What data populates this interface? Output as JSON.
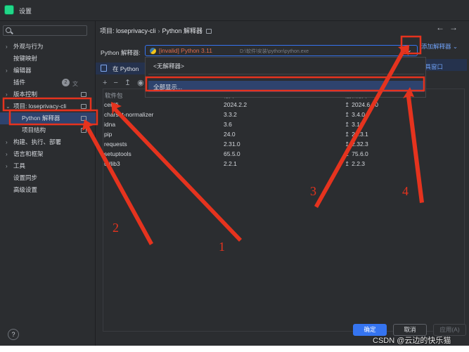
{
  "window": {
    "title": "设置"
  },
  "sidebar": {
    "search_placeholder": "Q",
    "items": [
      {
        "arrow": "›",
        "label": "外观与行为"
      },
      {
        "arrow": "",
        "label": "按键映射"
      },
      {
        "arrow": "›",
        "label": "编辑器"
      },
      {
        "arrow": "",
        "label": "插件",
        "badge": "2"
      },
      {
        "arrow": "›",
        "label": "版本控制"
      },
      {
        "arrow": "⌄",
        "label": "项目: loseprivacy-cli"
      },
      {
        "arrow": "",
        "label": "Python 解释器"
      },
      {
        "arrow": "",
        "label": "项目结构"
      },
      {
        "arrow": "›",
        "label": "构建、执行、部署"
      },
      {
        "arrow": "›",
        "label": "语言和框架"
      },
      {
        "arrow": "›",
        "label": "工具"
      },
      {
        "arrow": "",
        "label": "设置同步"
      },
      {
        "arrow": "",
        "label": "高级设置"
      }
    ],
    "help_label": "?"
  },
  "breadcrumb": {
    "project": "项目: loseprivacy-cli",
    "separator": "›",
    "page": "Python 解释器"
  },
  "nav": {
    "back": "←",
    "forward": "→"
  },
  "interpreter": {
    "label": "Python 解释器:",
    "invalid_text": "[invalid] Python 3.11",
    "path": "D:\\软件\\安装\\python\\python.exe",
    "add_link": "添加解释器 ⌄",
    "chevron": "⌄"
  },
  "notice": {
    "text": "在 Python",
    "tool_window_link": "工具窗口"
  },
  "dropdown": {
    "none_option": "<无解释器>",
    "show_all_option": "全部显示..."
  },
  "toolbar": {
    "add": "+",
    "remove": "−",
    "upgrade": "↥",
    "eye": "◉"
  },
  "table": {
    "headers": [
      "软件包",
      "版本",
      "最新版本"
    ],
    "rows": [
      [
        "certifi",
        "2024.2.2",
        "2024.6.30"
      ],
      [
        "charset-normalizer",
        "3.3.2",
        "3.4.0"
      ],
      [
        "idna",
        "3.6",
        "3.10"
      ],
      [
        "pip",
        "24.0",
        "24.3.1"
      ],
      [
        "requests",
        "2.31.0",
        "2.32.3"
      ],
      [
        "setuptools",
        "65.5.0",
        "75.6.0"
      ],
      [
        "urllib3",
        "2.2.1",
        "2.2.3"
      ]
    ]
  },
  "buttons": {
    "ok": "确定",
    "cancel": "取消",
    "apply": "应用(A)"
  },
  "annotations": {
    "numbers": [
      "1",
      "2",
      "3",
      "4"
    ],
    "color": "#e5331e"
  },
  "watermark": "CSDN @云边的快乐猫"
}
